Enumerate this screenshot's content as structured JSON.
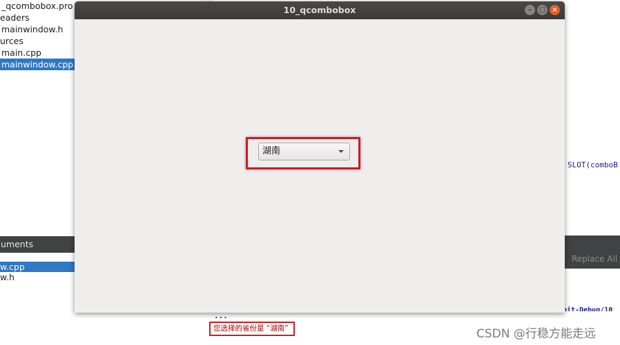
{
  "project_tree": {
    "items": [
      {
        "label": "_qcombobox.pro",
        "selected": false
      },
      {
        "label": "eaders",
        "selected": false
      },
      {
        "label": "mainwindow.h",
        "selected": false
      },
      {
        "label": "urces",
        "selected": false
      },
      {
        "label": "main.cpp",
        "selected": false
      },
      {
        "label": "mainwindow.cpp",
        "selected": true
      }
    ]
  },
  "open_documents": {
    "header": "uments",
    "items": [
      {
        "label": "w.cpp",
        "selected": true
      },
      {
        "label": "w.h",
        "selected": false
      }
    ]
  },
  "editor": {
    "code_fragment": "SLOT(comboB"
  },
  "find_bar": {
    "replace_all_label": "Replace All"
  },
  "output": {
    "build_path_fragment": "bit-Debug/10_",
    "dots": "...",
    "message": "您选择的省份是 “湖南”"
  },
  "app_window": {
    "title": "10_qcombobox",
    "buttons": {
      "minimize": "–",
      "maximize": "□",
      "close": "×"
    },
    "combobox": {
      "selected_value": "湖南"
    }
  },
  "watermark": "CSDN @行稳方能走远",
  "colors": {
    "selection": "#2f78c4",
    "highlight_border": "#d3191d",
    "titlebar": "#3b3a37",
    "close_button": "#e85b2a"
  }
}
